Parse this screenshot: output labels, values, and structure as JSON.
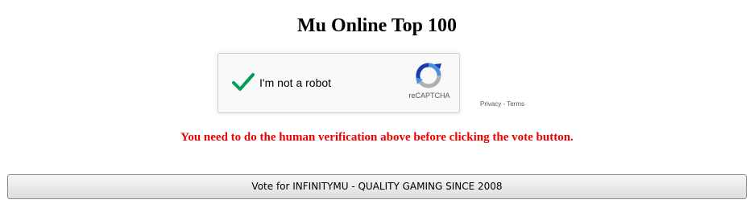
{
  "page": {
    "title": "Mu Online Top 100",
    "warning": "You need to do the human verification above before clicking the vote button."
  },
  "captcha": {
    "label": "I'm not a robot",
    "brand": "reCAPTCHA",
    "privacy_link": "Privacy",
    "separator": "-",
    "terms_link": "Terms",
    "checked": true,
    "check_icon": "checkmark-icon",
    "logo_icon": "recaptcha-logo-icon"
  },
  "vote": {
    "button_label": "Vote for INFINITYMU - QUALITY GAMING SINCE 2008"
  },
  "colors": {
    "warning": "#ee0000",
    "check": "#009e55",
    "recaptcha_blue": "#4a90e2",
    "recaptcha_dark_blue": "#1c3aa9",
    "recaptcha_gray": "#b0b0b0"
  }
}
